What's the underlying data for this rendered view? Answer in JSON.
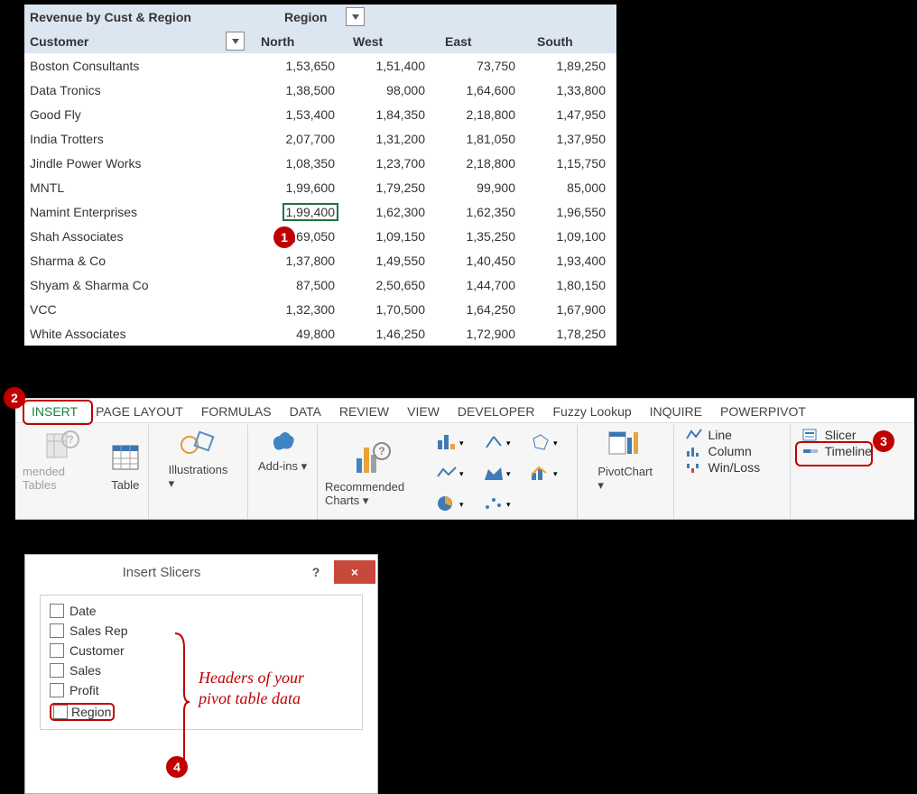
{
  "pivot": {
    "title": "Revenue by Cust & Region",
    "region_label": "Region",
    "customer_label": "Customer",
    "columns": [
      "North",
      "West",
      "East",
      "South"
    ],
    "rows": [
      {
        "customer": "Boston Consultants",
        "values": [
          "1,53,650",
          "1,51,400",
          "73,750",
          "1,89,250"
        ]
      },
      {
        "customer": "Data Tronics",
        "values": [
          "1,38,500",
          "98,000",
          "1,64,600",
          "1,33,800"
        ]
      },
      {
        "customer": "Good Fly",
        "values": [
          "1,53,400",
          "1,84,350",
          "2,18,800",
          "1,47,950"
        ]
      },
      {
        "customer": "India Trotters",
        "values": [
          "2,07,700",
          "1,31,200",
          "1,81,050",
          "1,37,950"
        ]
      },
      {
        "customer": "Jindle Power Works",
        "values": [
          "1,08,350",
          "1,23,700",
          "2,18,800",
          "1,15,750"
        ]
      },
      {
        "customer": "MNTL",
        "values": [
          "1,99,600",
          "1,79,250",
          "99,900",
          "85,000"
        ]
      },
      {
        "customer": "Namint Enterprises",
        "values": [
          "1,99,400",
          "1,62,300",
          "1,62,350",
          "1,96,550"
        ]
      },
      {
        "customer": "Shah Associates",
        "values": [
          "2,69,050",
          "1,09,150",
          "1,35,250",
          "1,09,100"
        ]
      },
      {
        "customer": "Sharma & Co",
        "values": [
          "1,37,800",
          "1,49,550",
          "1,40,450",
          "1,93,400"
        ]
      },
      {
        "customer": "Shyam & Sharma Co",
        "values": [
          "87,500",
          "2,50,650",
          "1,44,700",
          "1,80,150"
        ]
      },
      {
        "customer": "VCC",
        "values": [
          "1,32,300",
          "1,70,500",
          "1,64,250",
          "1,67,900"
        ]
      },
      {
        "customer": "White Associates",
        "values": [
          "49,800",
          "1,46,250",
          "1,72,900",
          "1,78,250"
        ]
      }
    ],
    "selected": {
      "row": 6,
      "col": 0
    }
  },
  "callouts": {
    "c1": "1",
    "c2": "2",
    "c3": "3",
    "c4": "4"
  },
  "ribbon": {
    "tabs": [
      "INSERT",
      "PAGE LAYOUT",
      "FORMULAS",
      "DATA",
      "REVIEW",
      "VIEW",
      "DEVELOPER",
      "Fuzzy Lookup",
      "INQUIRE",
      "POWERPIVOT"
    ],
    "active_tab": "INSERT",
    "buttons": {
      "rec_tables": "mended Tables",
      "rec_tables_full": "Recommended Tables",
      "table": "Table",
      "illustrations": "Illustrations",
      "addins": "Add-ins",
      "rec_charts": "Recommended Charts",
      "pivotchart": "PivotChart",
      "line": "Line",
      "column": "Column",
      "winloss": "Win/Loss",
      "slicer": "Slicer",
      "timeline": "Timeline"
    }
  },
  "dialog": {
    "title": "Insert Slicers",
    "help": "?",
    "close": "×",
    "fields": [
      "Date",
      "Sales Rep",
      "Customer",
      "Sales",
      "Profit",
      "Region"
    ]
  },
  "annotation": {
    "line1": "Headers of your",
    "line2": "pivot table data"
  }
}
